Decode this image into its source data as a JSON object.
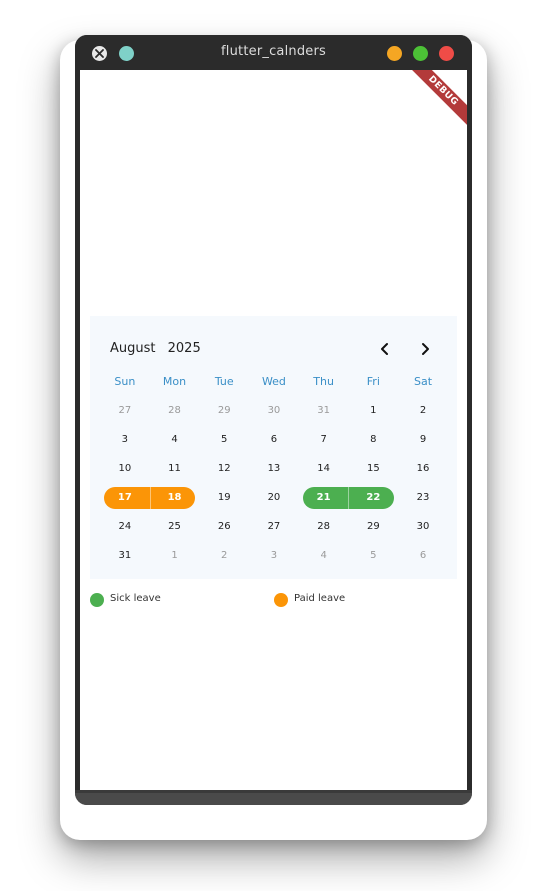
{
  "window": {
    "title": "flutter_calnders",
    "colors": {
      "teal": "#7fd1c8",
      "yellow": "#f5a623",
      "green": "#4cc136",
      "red": "#ef4c47"
    }
  },
  "debug_banner": "DEBUG",
  "calendar": {
    "month": "August",
    "year": "2025",
    "weekdays": [
      "Sun",
      "Mon",
      "Tue",
      "Wed",
      "Thu",
      "Fri",
      "Sat"
    ],
    "weeks": [
      [
        {
          "d": "27",
          "muted": true
        },
        {
          "d": "28",
          "muted": true
        },
        {
          "d": "29",
          "muted": true
        },
        {
          "d": "30",
          "muted": true
        },
        {
          "d": "31",
          "muted": true
        },
        {
          "d": "1"
        },
        {
          "d": "2"
        }
      ],
      [
        {
          "d": "3"
        },
        {
          "d": "4"
        },
        {
          "d": "5"
        },
        {
          "d": "6"
        },
        {
          "d": "7"
        },
        {
          "d": "8"
        },
        {
          "d": "9"
        }
      ],
      [
        {
          "d": "10"
        },
        {
          "d": "11"
        },
        {
          "d": "12"
        },
        {
          "d": "13"
        },
        {
          "d": "14"
        },
        {
          "d": "15"
        },
        {
          "d": "16"
        }
      ],
      [
        {
          "d": "17",
          "leave": "paid"
        },
        {
          "d": "18",
          "leave": "paid"
        },
        {
          "d": "19"
        },
        {
          "d": "20"
        },
        {
          "d": "21",
          "leave": "sick"
        },
        {
          "d": "22",
          "leave": "sick"
        },
        {
          "d": "23"
        }
      ],
      [
        {
          "d": "24"
        },
        {
          "d": "25"
        },
        {
          "d": "26"
        },
        {
          "d": "27"
        },
        {
          "d": "28"
        },
        {
          "d": "29"
        },
        {
          "d": "30"
        }
      ],
      [
        {
          "d": "31"
        },
        {
          "d": "1",
          "muted": true
        },
        {
          "d": "2",
          "muted": true
        },
        {
          "d": "3",
          "muted": true
        },
        {
          "d": "4",
          "muted": true
        },
        {
          "d": "5",
          "muted": true
        },
        {
          "d": "6",
          "muted": true
        }
      ]
    ],
    "leave_ranges": [
      {
        "type": "paid",
        "week": 3,
        "start": 0,
        "end": 1
      },
      {
        "type": "sick",
        "week": 3,
        "start": 4,
        "end": 5
      }
    ],
    "colors": {
      "paid": "#fb9507",
      "sick": "#4caf50",
      "weekday": "#3a8fc7"
    }
  },
  "legend": [
    {
      "label": "Sick leave",
      "color": "#4caf50"
    },
    {
      "label": "Paid leave",
      "color": "#fb9507"
    }
  ]
}
